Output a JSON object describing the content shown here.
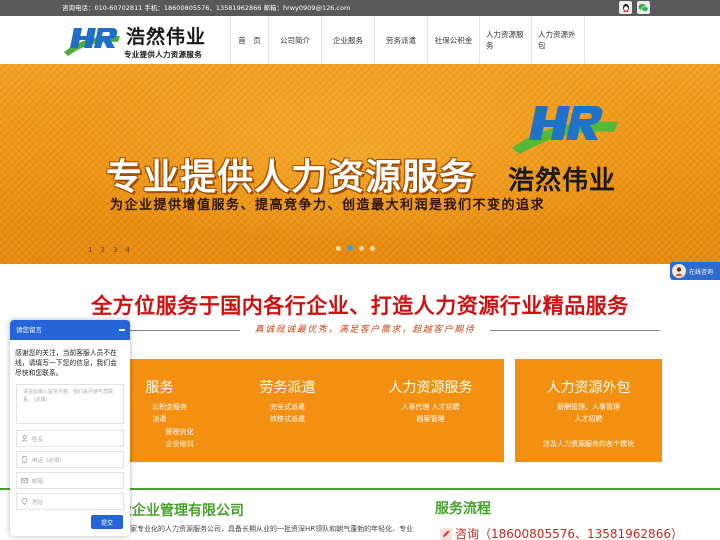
{
  "topbar": {
    "contact": "咨询电话：010-60702811 手机：18600805576、13581962866 邮箱：hrwy0909@126.com"
  },
  "logo": {
    "name": "浩然伟业",
    "slogan": "专业提供人力资源服务"
  },
  "nav": {
    "items": [
      "首　页",
      "公司简介",
      "企业服务",
      "劳务派遣",
      "社保公积金",
      "人力资源服务",
      "人力资源外包"
    ]
  },
  "banner": {
    "headline": "专业提供人力资源服务",
    "subline": "为企业提供增值服务、提高竞争力、创造最大利润是我们不变的追求",
    "brand": "浩然伟业",
    "slide_numbers": [
      "1",
      "2",
      "3",
      "4"
    ],
    "active_dot": 1
  },
  "online_service": {
    "label": "在线咨询"
  },
  "section": {
    "title": "全方位服务于国内各行企业、打造人力资源行业精品服务",
    "subtitle": "真诚就诚最优秀，满足客户需求，超越客户期待"
  },
  "cards": [
    {
      "title": "服务",
      "lines": [
        "公积金服务",
        "派遣",
        "薪税优化",
        "企业培训"
      ]
    },
    {
      "title": "劳务派遣",
      "lines": [
        "完全式派遣",
        "转移式派遣"
      ]
    },
    {
      "title": "人力资源服务",
      "lines": [
        "人事代理 人才招聘",
        "档案管理"
      ]
    },
    {
      "title": "人力资源外包",
      "lines": [
        "薪酬管理、人事管理",
        "人才招聘",
        "涉及人力资源服务的各个模块"
      ]
    }
  ],
  "about": {
    "company_name": "业企业管理有限公司",
    "description": "家专业化的人力资源服务公司，具备长期从业的一批资深HR领队和朝气蓬勃的年轻化、专业"
  },
  "flow": {
    "title": "服务流程",
    "first_item": "咨询（18600805576、13581962866）"
  },
  "chat": {
    "header": "请您留言",
    "message": "感谢您的关注，当前客服人员不在\n线，请填写一下您的信息，我们会\n尽快和您联系。",
    "textarea_placeholder": "请在此输入留言内容，我们会尽快与您联系。（必填）",
    "fields": [
      {
        "icon": "person-icon",
        "placeholder": "姓名"
      },
      {
        "icon": "phone-icon",
        "placeholder": "电话（必填）"
      },
      {
        "icon": "mail-icon",
        "placeholder": "邮箱"
      },
      {
        "icon": "location-icon",
        "placeholder": "地址"
      }
    ],
    "submit": "提交"
  },
  "colors": {
    "accent_red": "#d01010",
    "banner_orange": "#ef9412",
    "card_orange": "#f39012",
    "green": "#48a12d",
    "chat_blue": "#2466d8"
  }
}
